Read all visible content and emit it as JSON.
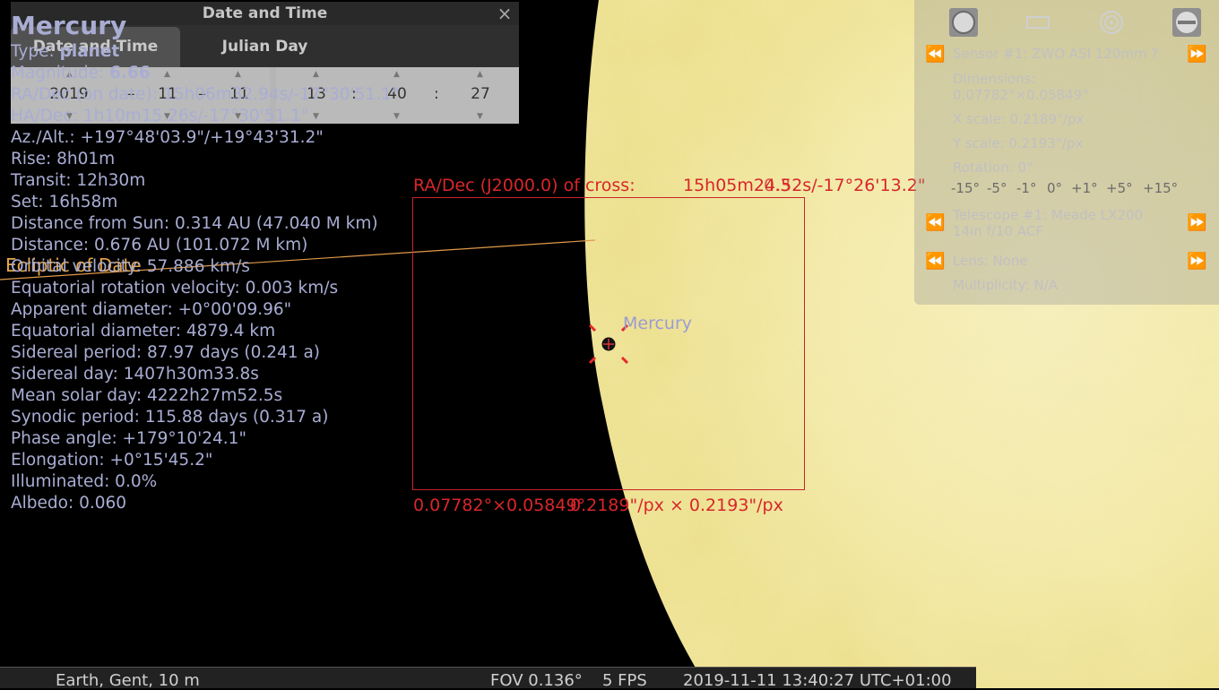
{
  "object": {
    "name": "Mercury",
    "type_label": "Type: ",
    "type_value": "planet",
    "magnitude_label": "Magnitude: ",
    "magnitude_value": "6.66",
    "lines": [
      "RA/Dec (on date): 15h06m32.94s/-17°30'51.1\"",
      "HA/Dec: 1h10m15.26s/-17°30'51.1\"",
      "Az./Alt.: +197°48'03.9\"/+19°43'31.2\"",
      "Rise: 8h01m",
      "Transit: 12h30m",
      "Set: 16h58m",
      "Distance from Sun: 0.314 AU (47.040 M km)",
      "Distance: 0.676 AU (101.072 M km)",
      "Orbital velocity: 57.886 km/s",
      "Equatorial rotation velocity: 0.003 km/s",
      "Apparent diameter: +0°00'09.96\"",
      "Equatorial diameter: 4879.4 km",
      "Sidereal period: 87.97 days (0.241 a)",
      "Sidereal day: 1407h30m33.8s",
      "Mean solar day: 4222h27m52.5s",
      "Synodic period: 115.88 days (0.317 a)",
      "Phase angle: +179°10'24.1\"",
      "Elongation: +0°15'45.2\"",
      "Illuminated: 0.0%",
      "Albedo: 0.060"
    ],
    "sky_label": "Mercury"
  },
  "datetime_dialog": {
    "title": "Date and Time",
    "close": "×",
    "tabs": [
      "Date and Time",
      "Julian Day"
    ],
    "year": "2019",
    "month": "11",
    "day": "11",
    "hour": "13",
    "minute": "40",
    "second": "27",
    "date_sep": "–",
    "time_sep": ":"
  },
  "ocular_panel": {
    "sensor": "Sensor #1: ZWO ASI 120mm ?",
    "dimensions_label": "Dimensions:",
    "dimensions_value": "0.07782°×0.05849°",
    "x_scale": "X scale: 0.2189\"/px",
    "y_scale": "Y scale: 0.2193\"/px",
    "rotation": "Rotation: 0°",
    "rotation_buttons": [
      "-15°",
      "-5°",
      "-1°",
      "0°",
      "+1°",
      "+5°",
      "+15°"
    ],
    "telescope_line1": "Telescope #1: Meade  LX200",
    "telescope_line2": "14in f/10 ACF",
    "lens": "Lens: None",
    "multiplicity": "Multiplicity: N/A"
  },
  "ccd_overlay": {
    "radec_label": "RA/Dec (J2000.0) of cross:",
    "radec_value": "15h05m24.52s/-17°26'13.2\"",
    "radec_overlap": "0.3",
    "dimensions": "0.07782°×0.05849°",
    "scale": "0.2189\"/px × 0.2193\"/px"
  },
  "ecliptic_label": "Ecliptic of Date",
  "status_bar": {
    "location": "Earth, Gent, 10 m",
    "fov": "FOV 0.136°",
    "fps": "5 FPS",
    "datetime": "2019-11-11 13:40:27 UTC+01:00"
  },
  "colors": {
    "sun": "#f3ebb0",
    "info_text": "#a9add3",
    "ccd_red": "#d8262a",
    "ecliptic": "#e6a64a"
  }
}
